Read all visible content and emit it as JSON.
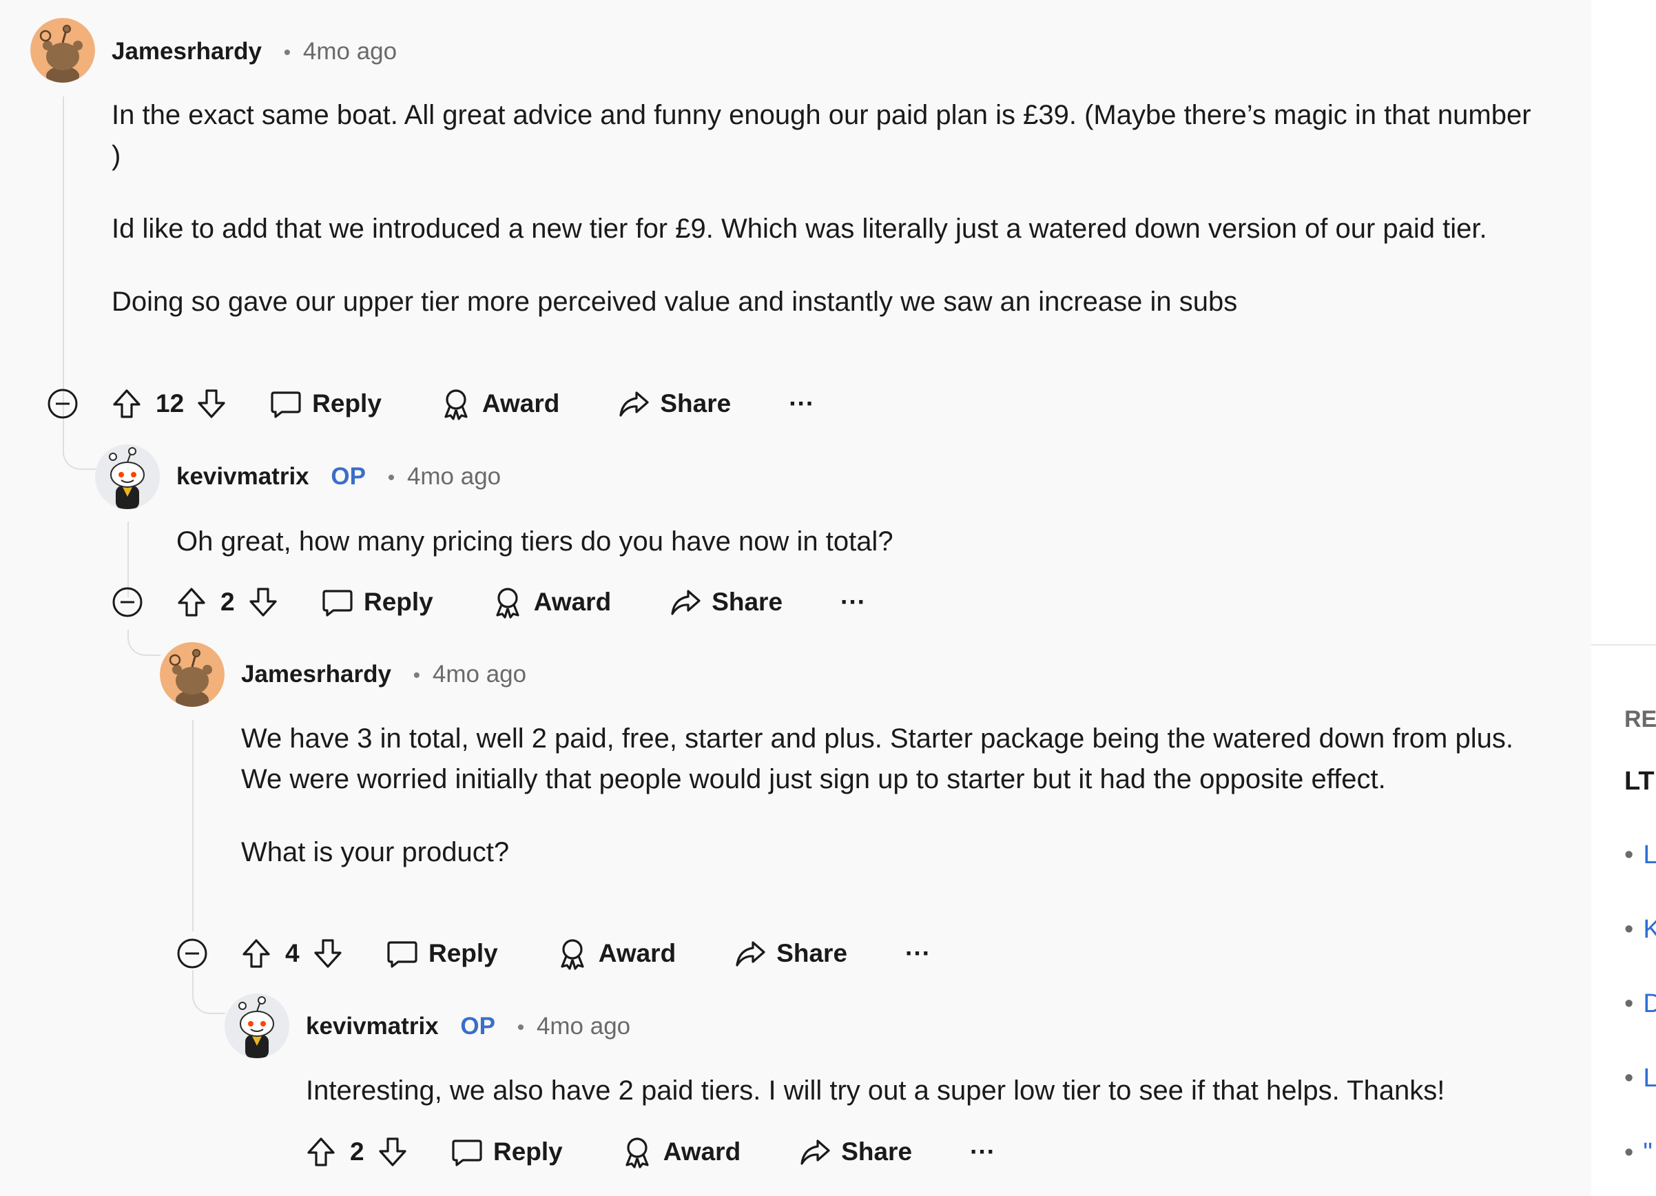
{
  "comments": [
    {
      "author": "Jamesrhardy",
      "op_badge": "",
      "time": "4mo ago",
      "avatar": "orange-snoo-avatar",
      "paragraphs": [
        "In the exact same boat. All great advice and funny enough our paid plan is £39. (Maybe there’s magic in that number )",
        "Id like to add that we introduced a new tier for £9. Which was literally just a watered down version of our paid tier.",
        "Doing so gave our upper tier more perceived value and instantly we saw an increase in subs"
      ],
      "score": "12"
    },
    {
      "author": "kevivmatrix",
      "op_badge": "OP",
      "time": "4mo ago",
      "avatar": "white-snoo-avatar",
      "paragraphs": [
        "Oh great, how many pricing tiers do you have now in total?"
      ],
      "score": "2"
    },
    {
      "author": "Jamesrhardy",
      "op_badge": "",
      "time": "4mo ago",
      "avatar": "orange-snoo-avatar",
      "paragraphs": [
        "We have 3 in total, well 2 paid, free, starter and plus. Starter package being the watered down from plus. We were worried initially that people would just sign up to starter but it had the opposite effect.",
        "What is your product?"
      ],
      "score": "4"
    },
    {
      "author": "kevivmatrix",
      "op_badge": "OP",
      "time": "4mo ago",
      "avatar": "white-snoo-avatar",
      "paragraphs": [
        "Interesting, we also have 2 paid tiers. I will try out a super low tier to see if that helps. Thanks!"
      ],
      "score": "2"
    }
  ],
  "actions": {
    "reply": "Reply",
    "award": "Award",
    "share": "Share",
    "more": "···"
  },
  "separator": "•",
  "sidebar": {
    "header": "RE",
    "subheader": "LT",
    "bullet": "•",
    "items": [
      "L",
      "K",
      "D",
      "L",
      "\""
    ]
  },
  "colors": {
    "background": "#f9f9f9",
    "op_badge": "#3a6ec8",
    "link": "#2c6fd6",
    "thread_line": "#dcdfe2",
    "orange_avatar": "#f2b07a"
  }
}
